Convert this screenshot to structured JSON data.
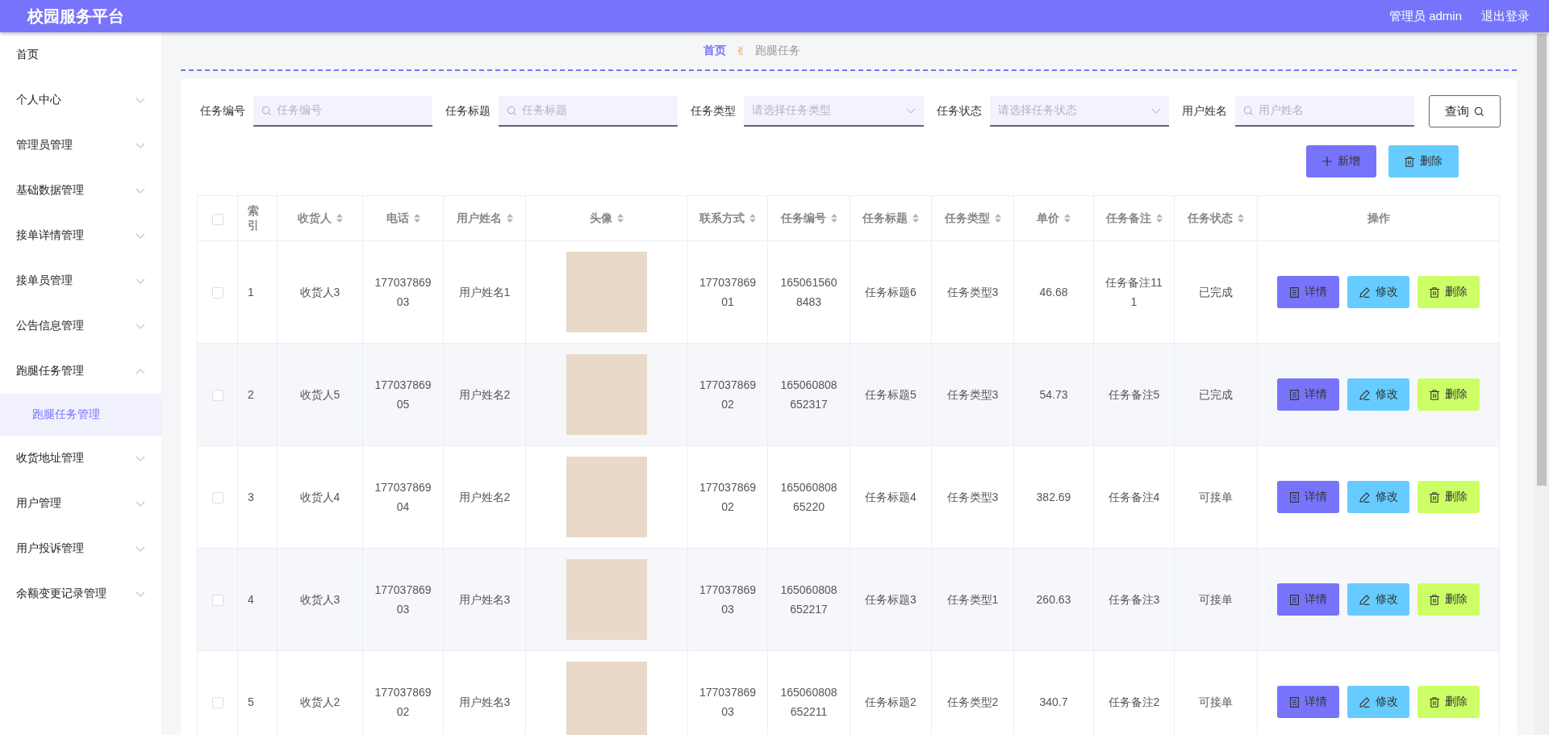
{
  "header": {
    "title": "校园服务平台",
    "user": "管理员 admin",
    "logout": "退出登录"
  },
  "sidebar": {
    "items": [
      {
        "label": "首页"
      },
      {
        "label": "个人中心",
        "expanded": false
      },
      {
        "label": "管理员管理",
        "expanded": false
      },
      {
        "label": "基础数据管理",
        "expanded": false
      },
      {
        "label": "接单详情管理",
        "expanded": false
      },
      {
        "label": "接单员管理",
        "expanded": false
      },
      {
        "label": "公告信息管理",
        "expanded": false
      },
      {
        "label": "跑腿任务管理",
        "expanded": true,
        "children": [
          {
            "label": "跑腿任务管理",
            "selected": true
          }
        ]
      },
      {
        "label": "收货地址管理",
        "expanded": false
      },
      {
        "label": "用户管理",
        "expanded": false
      },
      {
        "label": "用户投诉管理",
        "expanded": false
      },
      {
        "label": "余额变更记录管理",
        "expanded": false
      }
    ]
  },
  "breadcrumb": {
    "home": "首页",
    "separator": "✌",
    "current": "跑腿任务"
  },
  "filters": [
    {
      "label": "任务编号",
      "kind": "text",
      "placeholder": "任务编号"
    },
    {
      "label": "任务标题",
      "kind": "text",
      "placeholder": "任务标题"
    },
    {
      "label": "任务类型",
      "kind": "select",
      "placeholder": "请选择任务类型"
    },
    {
      "label": "任务状态",
      "kind": "select",
      "placeholder": "请选择任务状态"
    },
    {
      "label": "用户姓名",
      "kind": "text",
      "placeholder": "用户姓名"
    }
  ],
  "query_button": "查询",
  "toolbar": [
    {
      "label": "新增",
      "kind": "add"
    },
    {
      "label": "删除",
      "kind": "delete"
    }
  ],
  "table": {
    "select_all": {
      "checked": false
    },
    "columns": [
      {
        "label": "索引",
        "sortable": false
      },
      {
        "label": "收货人",
        "sortable": true
      },
      {
        "label": "电话",
        "sortable": true
      },
      {
        "label": "用户姓名",
        "sortable": true
      },
      {
        "label": "头像",
        "sortable": true
      },
      {
        "label": "联系方式",
        "sortable": true
      },
      {
        "label": "任务编号",
        "sortable": true
      },
      {
        "label": "任务标题",
        "sortable": true
      },
      {
        "label": "任务类型",
        "sortable": true
      },
      {
        "label": "单价",
        "sortable": true
      },
      {
        "label": "任务备注",
        "sortable": true
      },
      {
        "label": "任务状态",
        "sortable": true
      },
      {
        "label": "操作",
        "sortable": false
      }
    ],
    "rows": [
      {
        "checked": false,
        "cells": [
          "1",
          "收货人3",
          "17703786903",
          "用户姓名1",
          "",
          "17703786901",
          "1650615608483",
          "任务标题6",
          "任务类型3",
          "46.68",
          "任务备注111",
          "已完成"
        ],
        "actions": [
          {
            "label": "详情",
            "kind": "detail"
          },
          {
            "label": "修改",
            "kind": "edit"
          },
          {
            "label": "删除",
            "kind": "delete"
          }
        ]
      },
      {
        "checked": false,
        "cells": [
          "2",
          "收货人5",
          "17703786905",
          "用户姓名2",
          "",
          "17703786902",
          "165060808652317",
          "任务标题5",
          "任务类型3",
          "54.73",
          "任务备注5",
          "已完成"
        ],
        "actions": [
          {
            "label": "详情",
            "kind": "detail"
          },
          {
            "label": "修改",
            "kind": "edit"
          },
          {
            "label": "删除",
            "kind": "delete"
          }
        ]
      },
      {
        "checked": false,
        "cells": [
          "3",
          "收货人4",
          "17703786904",
          "用户姓名2",
          "",
          "17703786902",
          "16506080865220",
          "任务标题4",
          "任务类型3",
          "382.69",
          "任务备注4",
          "可接单"
        ],
        "actions": [
          {
            "label": "详情",
            "kind": "detail"
          },
          {
            "label": "修改",
            "kind": "edit"
          },
          {
            "label": "删除",
            "kind": "delete"
          }
        ]
      },
      {
        "checked": false,
        "cells": [
          "4",
          "收货人3",
          "17703786903",
          "用户姓名3",
          "",
          "17703786903",
          "165060808652217",
          "任务标题3",
          "任务类型1",
          "260.63",
          "任务备注3",
          "可接单"
        ],
        "actions": [
          {
            "label": "详情",
            "kind": "detail"
          },
          {
            "label": "修改",
            "kind": "edit"
          },
          {
            "label": "删除",
            "kind": "delete"
          }
        ]
      },
      {
        "checked": false,
        "cells": [
          "5",
          "收货人2",
          "17703786902",
          "用户姓名3",
          "",
          "17703786903",
          "165060808652211",
          "任务标题2",
          "任务类型2",
          "340.7",
          "任务备注2",
          "可接单"
        ],
        "actions": [
          {
            "label": "详情",
            "kind": "detail"
          },
          {
            "label": "修改",
            "kind": "edit"
          },
          {
            "label": "删除",
            "kind": "delete"
          }
        ]
      }
    ]
  }
}
